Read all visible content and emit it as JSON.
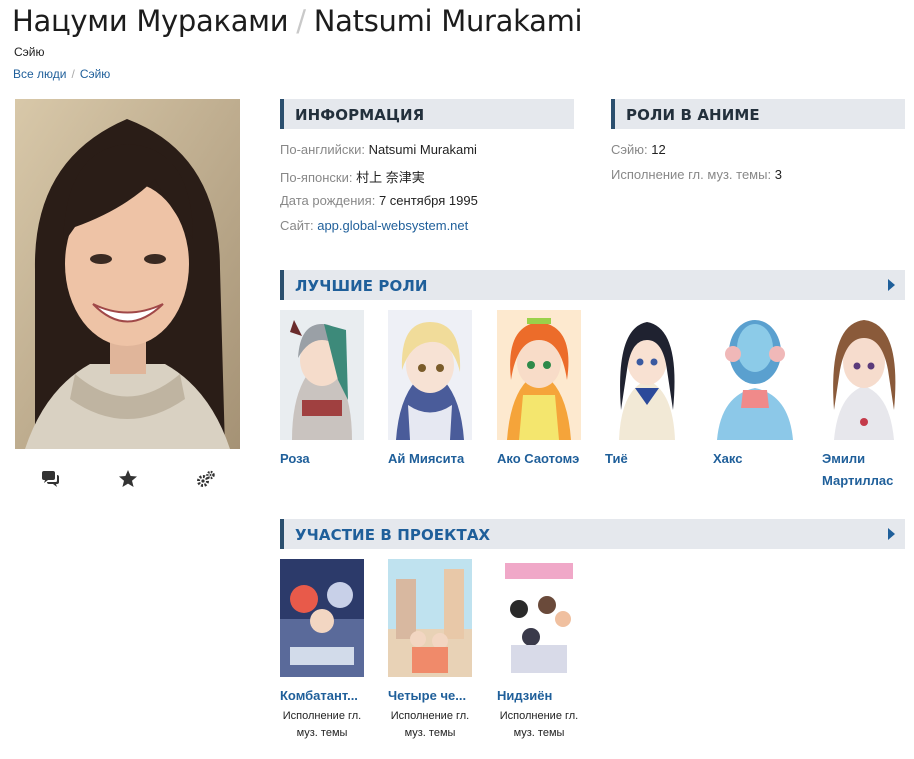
{
  "header": {
    "title_ru": "Нацуми Мураками",
    "title_sep": "/",
    "title_en": "Natsumi Murakami",
    "subtitle": "Сэйю"
  },
  "breadcrumb": {
    "items": [
      "Все люди",
      "Сэйю"
    ],
    "divider": "/"
  },
  "actions": {
    "icons": [
      "comments-icon",
      "star-icon",
      "cogs-icon"
    ]
  },
  "info": {
    "heading": "Информация",
    "rows": [
      {
        "label": "По-английски:",
        "value": "Natsumi Murakami"
      },
      {
        "label": "По-японски:",
        "value": "村上 奈津実"
      },
      {
        "label": "Дата рождения:",
        "value": "7 сентября 1995"
      },
      {
        "label": "Сайт:",
        "value": "app.global-websystem.net"
      }
    ]
  },
  "anime_roles": {
    "heading": "Роли в аниме",
    "rows": [
      {
        "label": "Сэйю:",
        "value": "12"
      },
      {
        "label": "Исполнение гл. муз. темы:",
        "value": "3"
      }
    ]
  },
  "best_roles": {
    "heading": "Лучшие роли",
    "items": [
      {
        "name": "Роза"
      },
      {
        "name": "Ай Миясита"
      },
      {
        "name": "Ако Саотомэ"
      },
      {
        "name": "Тиё"
      },
      {
        "name": "Хакс"
      },
      {
        "name": "Эмили Мартиллас"
      }
    ]
  },
  "projects": {
    "heading": "Участие в проектах",
    "items": [
      {
        "title": "Комбатант...",
        "role": "Исполнение гл. муз. темы"
      },
      {
        "title": "Четыре че...",
        "role": "Исполнение гл. муз. темы"
      },
      {
        "title": "Нидзиён",
        "role": "Исполнение гл. муз. темы"
      }
    ]
  },
  "colors": {
    "link": "#1f5f9a",
    "section_bg": "#e5e8ed",
    "section_border": "#2b4f6e",
    "muted": "#888888"
  }
}
